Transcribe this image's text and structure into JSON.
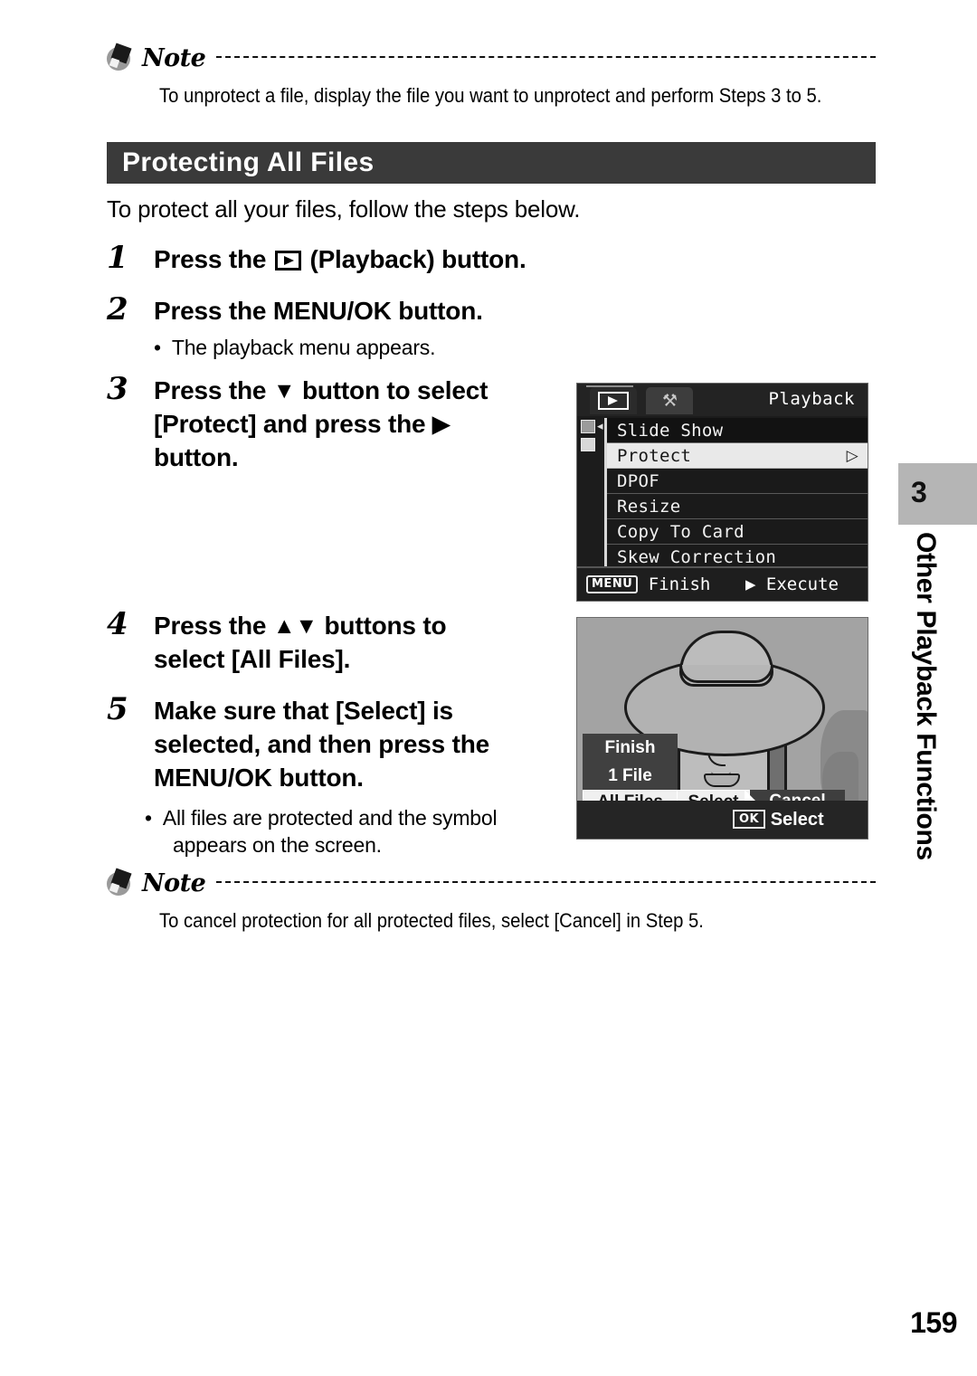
{
  "notes": [
    {
      "label": "Note",
      "text": "To unprotect a file, display the file you want to unprotect and perform Steps 3 to 5."
    },
    {
      "label": "Note",
      "text": "To cancel protection for all protected files, select [Cancel] in Step 5."
    }
  ],
  "section": {
    "title": "Protecting All Files",
    "intro": "To protect all your files, follow the steps below."
  },
  "steps": [
    {
      "num": "1",
      "text_before": "Press the ",
      "icon": "playback-icon",
      "text_after": " (Playback) button."
    },
    {
      "num": "2",
      "text": "Press the MENU/OK button.",
      "bullet": "The playback menu appears."
    },
    {
      "num": "3",
      "line1_before": "Press the ",
      "line1_icon": "▼",
      "line1_after": " button to select",
      "line2_before": "[Protect] and press the ",
      "line2_icon": "▶",
      "line3": "button."
    },
    {
      "num": "4",
      "line1_before": "Press the ",
      "line1_icon": "▲▼",
      "line1_after": " buttons to",
      "line2": "select [All Files]."
    },
    {
      "num": "5",
      "line1": "Make sure that [Select] is",
      "line2": "selected, and then press the",
      "line3": "MENU/OK button.",
      "bullet1": "All files are protected and the symbol",
      "bullet2": "appears on the screen."
    }
  ],
  "chapter": {
    "number": "3",
    "title": "Other Playback Functions"
  },
  "lcd_menu": {
    "screen_title": "Playback",
    "tabs": [
      {
        "name": "playback-tab",
        "icon": "playback-icon",
        "active": true
      },
      {
        "name": "setup-tab",
        "icon": "wrench-screwdriver-icon",
        "active": false
      }
    ],
    "items": [
      {
        "label": "Slide Show",
        "selected": false,
        "arrow": ""
      },
      {
        "label": "Protect",
        "selected": true,
        "arrow": "▷"
      },
      {
        "label": "DPOF",
        "selected": false,
        "arrow": ""
      },
      {
        "label": "Resize",
        "selected": false,
        "arrow": ""
      },
      {
        "label": "Copy To Card",
        "selected": false,
        "arrow": ""
      },
      {
        "label": "Skew Correction",
        "selected": false,
        "arrow": ""
      }
    ],
    "footer": {
      "left_key": "MENU",
      "left_label": "Finish",
      "right_key": "▶",
      "right_label": "Execute"
    }
  },
  "lcd_photo": {
    "dialog": {
      "title": "Finish",
      "subtitle": "1 File",
      "buttons": [
        {
          "label": "All Files",
          "state": "highlighted"
        },
        {
          "label": "Select",
          "state": "highlighted"
        },
        {
          "label": "Cancel",
          "state": "normal"
        }
      ]
    },
    "footer": {
      "key": "OK",
      "label": "Select"
    }
  },
  "page_number": "159"
}
